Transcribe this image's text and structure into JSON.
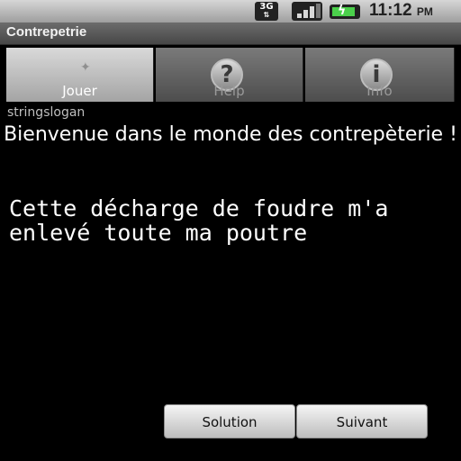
{
  "status_bar": {
    "network": "3G",
    "time": "11:12",
    "ampm": "PM"
  },
  "app": {
    "title": "Contrepetrie"
  },
  "tabs": [
    {
      "label": "Jouer",
      "icon": "star-icon",
      "selected": true
    },
    {
      "label": "Help",
      "icon": "question-icon",
      "selected": false
    },
    {
      "label": "Info",
      "icon": "info-icon",
      "selected": false
    }
  ],
  "content": {
    "slogan": "stringslogan",
    "welcome": "Bienvenue dans le monde des contrepèterie !",
    "phrase": "Cette décharge de foudre m'a enlevé toute ma poutre"
  },
  "buttons": {
    "solution": "Solution",
    "next": "Suivant"
  }
}
